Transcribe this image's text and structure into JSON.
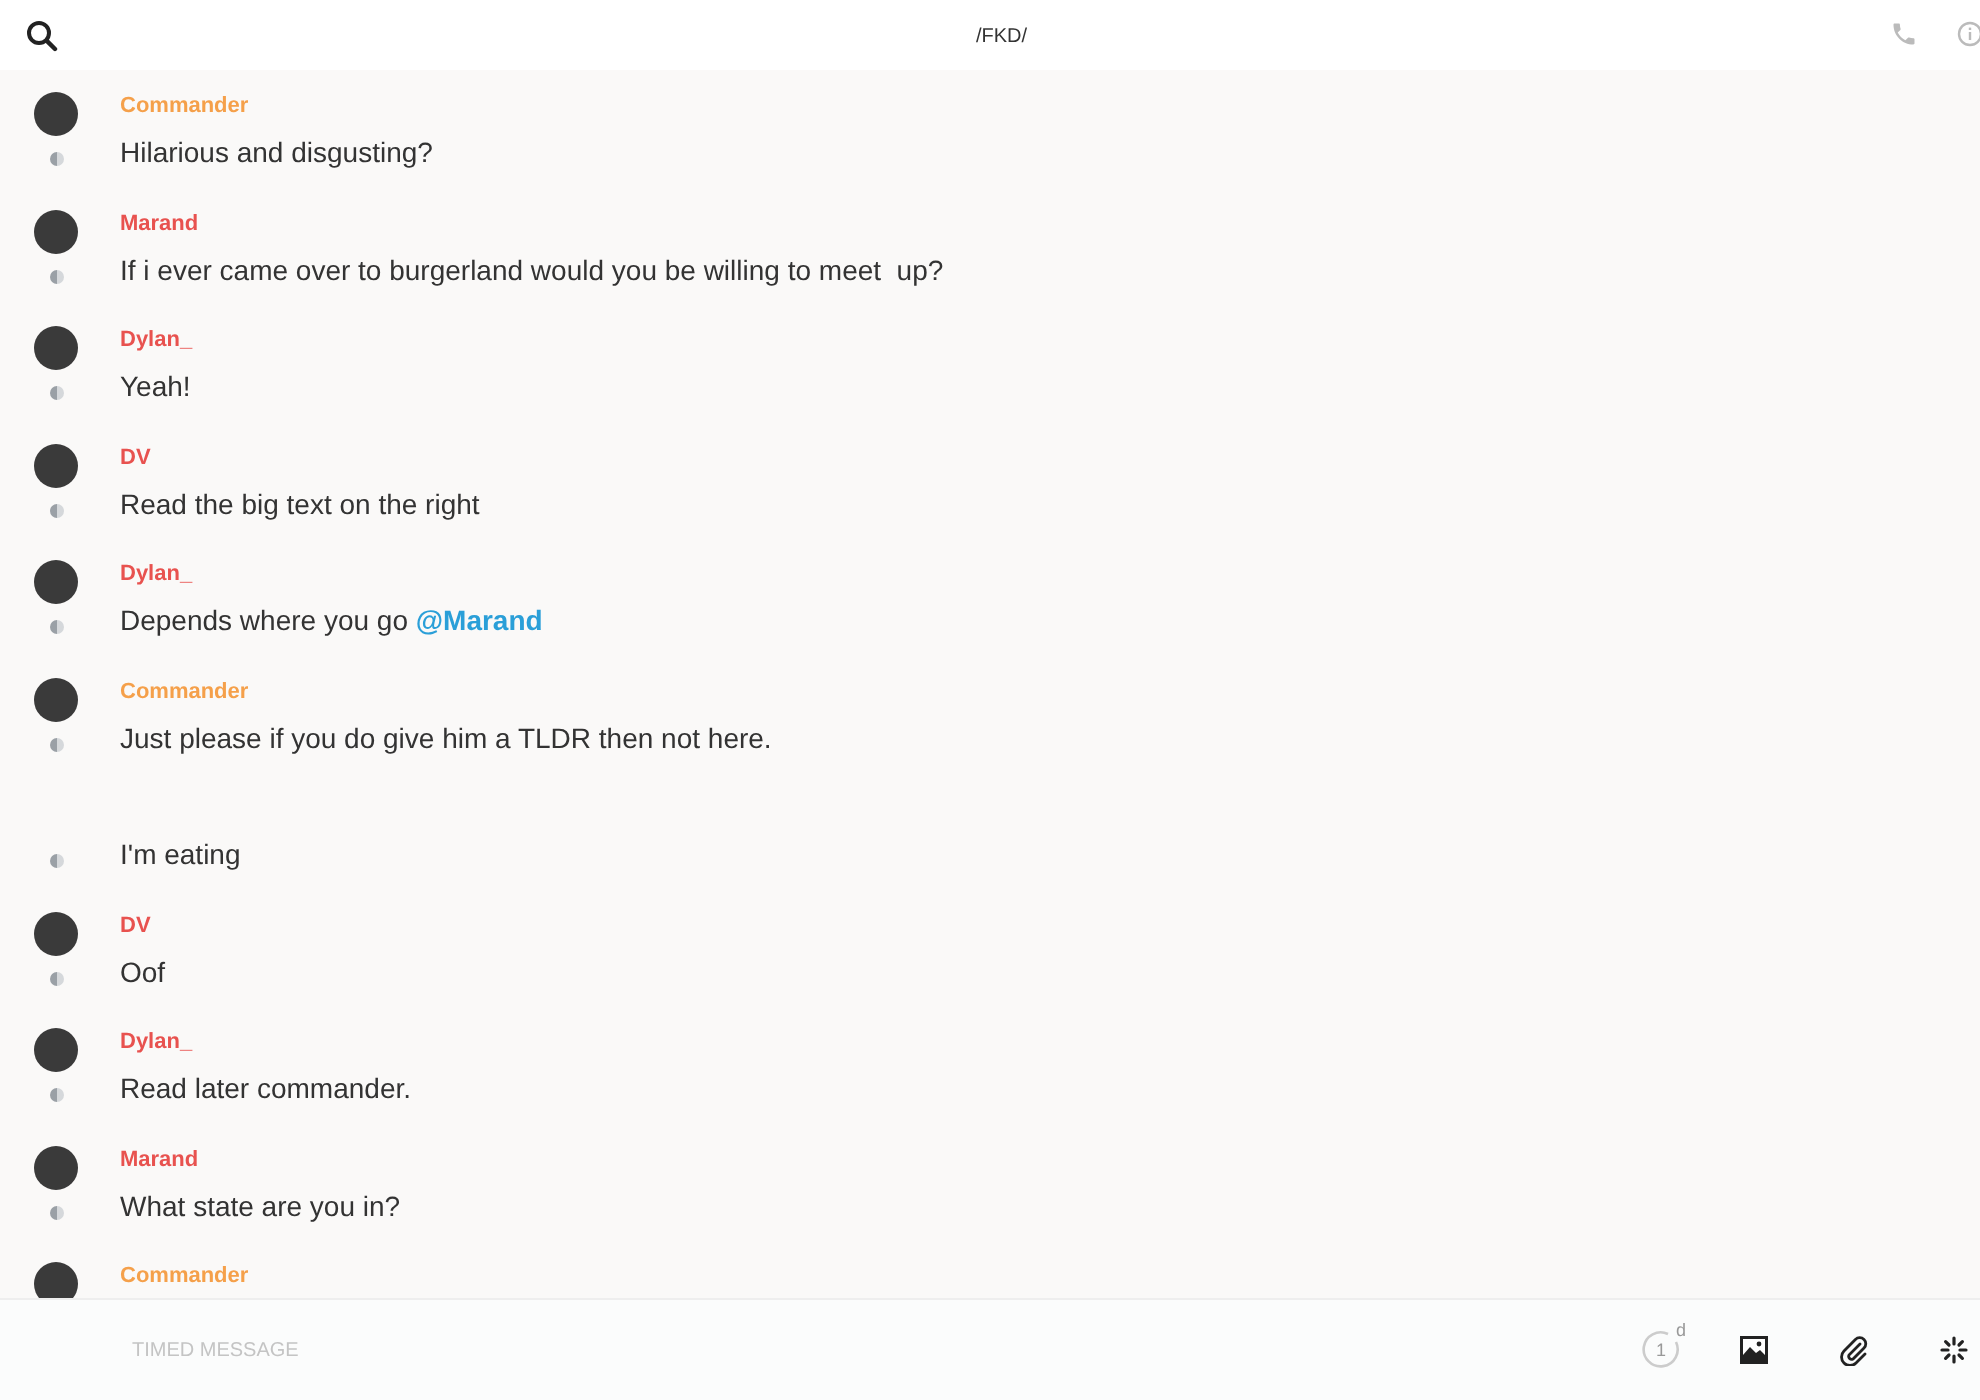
{
  "header": {
    "title": "/FKD/"
  },
  "messages": [
    {
      "author": "Commander",
      "color": "#f5a04a",
      "text": "Hilarious and disgusting?"
    },
    {
      "author": "Marand",
      "color": "#e8524f",
      "text": "If i ever came over to burgerland would you be willing to meet  up?"
    },
    {
      "author": "Dylan_",
      "color": "#e8524f",
      "text": "Yeah!"
    },
    {
      "author": "DV",
      "color": "#e8524f",
      "text": "Read the big text on the right"
    },
    {
      "author": "Dylan_",
      "color": "#e8524f",
      "text": "Depends where you go ",
      "mention": "@Marand"
    },
    {
      "author": "Commander",
      "color": "#f5a04a",
      "text": "Just please if you do give him a TLDR then not here."
    },
    {
      "text": "I'm eating"
    },
    {
      "author": "DV",
      "color": "#e8524f",
      "text": "Oof"
    },
    {
      "author": "Dylan_",
      "color": "#e8524f",
      "text": "Read later commander."
    },
    {
      "author": "Marand",
      "color": "#e8524f",
      "text": "What state are you in?"
    },
    {
      "author": "Commander",
      "color": "#f5a04a"
    }
  ],
  "composer": {
    "placeholder": "TIMED MESSAGE",
    "timer": {
      "count": "1",
      "unit": "d"
    }
  }
}
